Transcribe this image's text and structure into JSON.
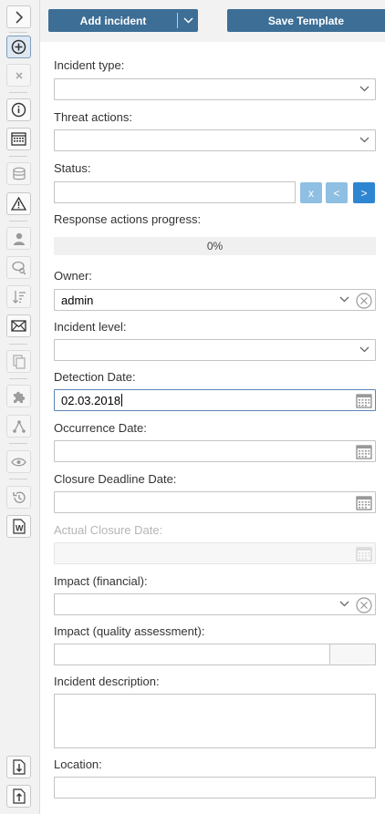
{
  "toolbar": {
    "icons": [
      "expand-arrow-icon",
      "add-circle-icon",
      "close-x-icon",
      "info-icon",
      "calendar-grid-icon",
      "database-icon",
      "warning-icon",
      "user-icon",
      "chat-search-icon",
      "sort-icon",
      "envelope-icon",
      "documents-icon",
      "puzzle-icon",
      "graph-icon",
      "eye-icon",
      "history-icon",
      "word-doc-icon",
      "import-icon",
      "export-icon"
    ]
  },
  "actions": {
    "add_incident": "Add incident",
    "save_template": "Save Template"
  },
  "form": {
    "incident_type": {
      "label": "Incident type:",
      "value": ""
    },
    "threat_actions": {
      "label": "Threat actions:",
      "value": ""
    },
    "status": {
      "label": "Status:",
      "value": "",
      "buttons": [
        "x",
        "<",
        ">"
      ]
    },
    "response_progress": {
      "label": "Response actions progress:",
      "value_text": "0%",
      "fraction": 0
    },
    "owner": {
      "label": "Owner:",
      "value": "admin"
    },
    "incident_level": {
      "label": "Incident level:",
      "value": ""
    },
    "detection_date": {
      "label": "Detection Date:",
      "value": "02.03.2018"
    },
    "occurrence_date": {
      "label": "Occurrence Date:",
      "value": ""
    },
    "closure_deadline_date": {
      "label": "Closure Deadline Date:",
      "value": ""
    },
    "actual_closure_date": {
      "label": "Actual Closure Date:",
      "value": ""
    },
    "impact_financial": {
      "label": "Impact (financial):",
      "value": ""
    },
    "impact_quality": {
      "label": "Impact (quality assessment):",
      "value": ""
    },
    "incident_description": {
      "label": "Incident description:",
      "value": ""
    },
    "location": {
      "label": "Location:",
      "value": ""
    }
  },
  "colors": {
    "primary": "#3d6e96",
    "status_btn_light": "#8fbfe3",
    "status_btn_active": "#2f86d0"
  }
}
